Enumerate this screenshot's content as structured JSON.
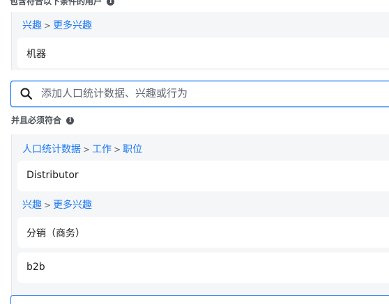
{
  "top_heading": "包含符合以下条件的用户",
  "include_group": {
    "crumbs": [
      "兴趣",
      "更多兴趣"
    ],
    "tags": [
      "机器"
    ]
  },
  "search": {
    "placeholder": "添加人口统计数据、兴趣或行为",
    "value": ""
  },
  "narrow_label": "并且必须符合",
  "narrow_group": {
    "section1": {
      "crumbs": [
        "人口统计数据",
        "工作",
        "职位"
      ],
      "tags": [
        "Distributor"
      ]
    },
    "section2": {
      "crumbs": [
        "兴趣",
        "更多兴趣"
      ],
      "tags": [
        "分销（商务）",
        "b2b"
      ]
    }
  },
  "colors": {
    "link": "#1877f2",
    "panel_bg": "#f5f6f7",
    "focus_border": "#1877f2"
  },
  "icons": {
    "info": "info-icon",
    "search": "search-icon"
  }
}
